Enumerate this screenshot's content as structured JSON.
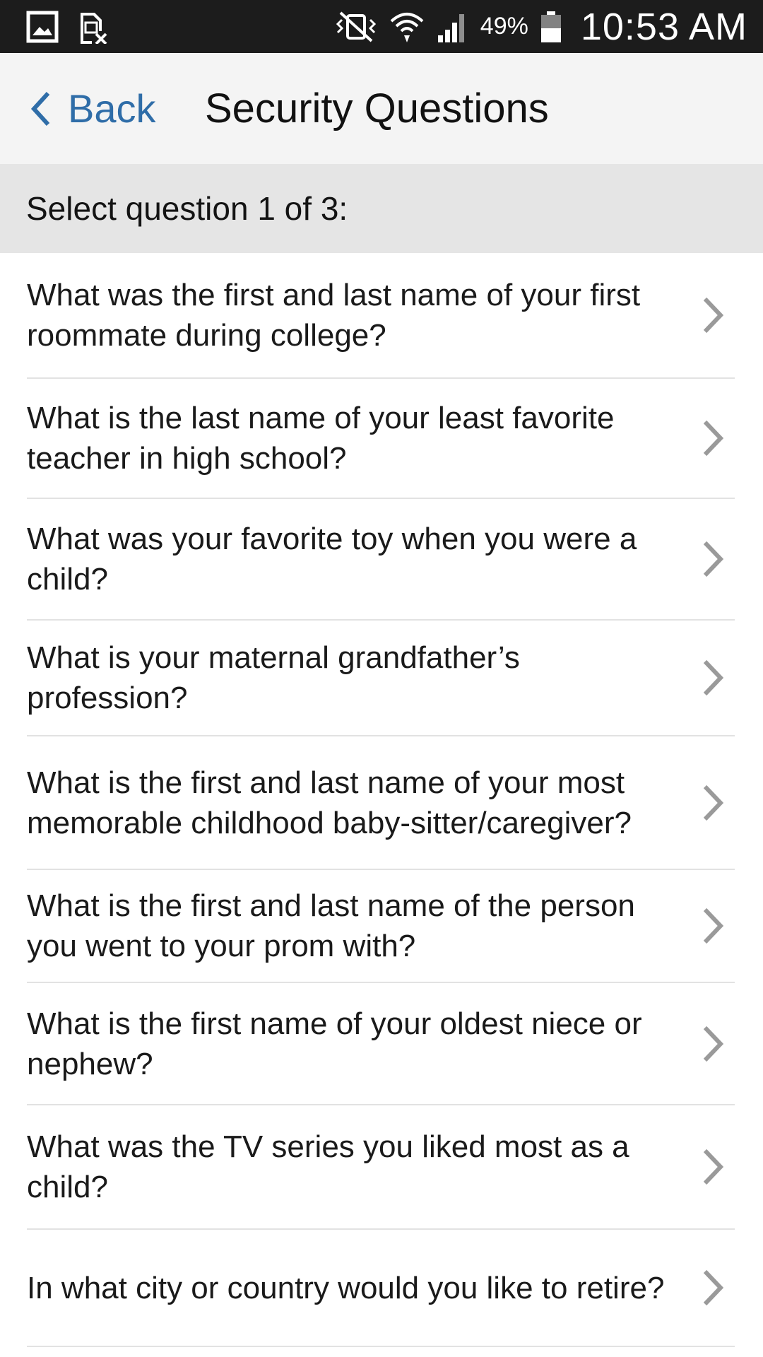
{
  "status_bar": {
    "battery_percent": "49%",
    "time": "10:53 AM",
    "icons": [
      "gallery-icon",
      "no-sim-icon",
      "vibrate-icon",
      "wifi-icon",
      "signal-icon",
      "battery-icon"
    ]
  },
  "nav": {
    "back_label": "Back",
    "title": "Security Questions",
    "accent_color": "#2f6da8"
  },
  "section": {
    "header": "Select question 1 of 3:"
  },
  "questions": [
    {
      "text": "What was the first and last name of your first roommate during college?"
    },
    {
      "text": "What is the last name of your least favorite teacher in high school?"
    },
    {
      "text": "What was your favorite toy when you were a child?"
    },
    {
      "text": "What is your maternal grandfather’s profession?"
    },
    {
      "text": "What is the first and last name of your most memorable childhood baby-sitter/caregiver?"
    },
    {
      "text": "What is the first and last name of the person you went to your prom with?"
    },
    {
      "text": "What is the first name of your oldest niece or nephew?"
    },
    {
      "text": "What was the TV series you liked most as a child?"
    },
    {
      "text": "In what city or country would you like to retire?"
    }
  ]
}
